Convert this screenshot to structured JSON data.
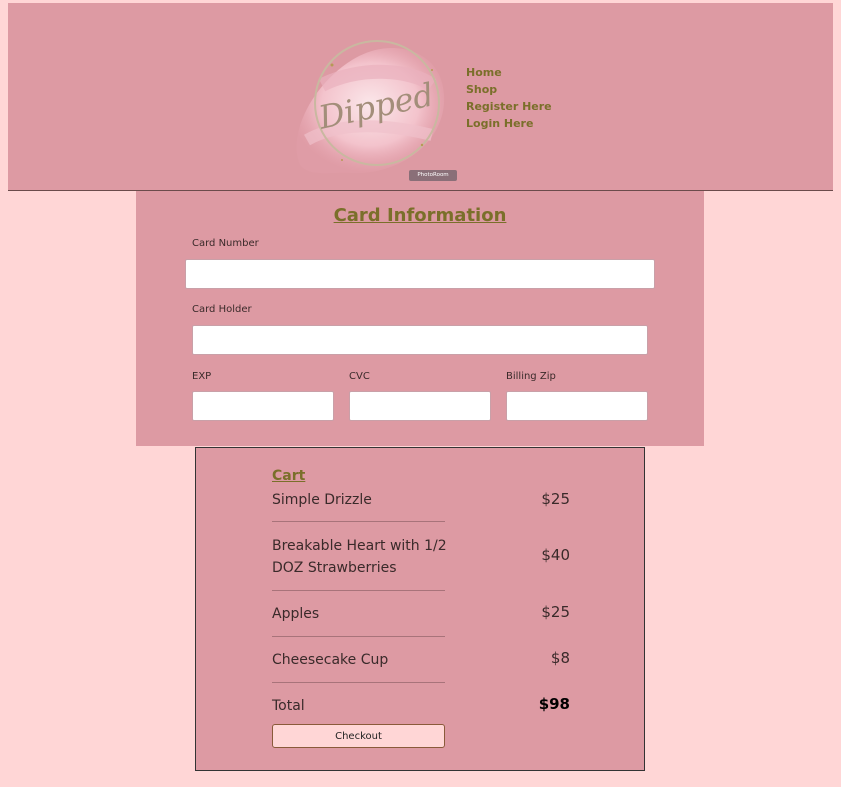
{
  "brand": {
    "logo_text": "Dipped",
    "watermark": "PhotoRoom"
  },
  "nav": {
    "items": [
      "Home",
      "Shop",
      "Register Here",
      "Login Here"
    ]
  },
  "card_form": {
    "title": "Card Information",
    "card_number_label": "Card Number",
    "card_number_value": "",
    "card_holder_label": "Card Holder",
    "card_holder_value": "",
    "exp_label": "EXP",
    "exp_value": "",
    "cvc_label": "CVC",
    "cvc_value": "",
    "zip_label": "Billing Zip",
    "zip_value": ""
  },
  "cart": {
    "title": "Cart",
    "items": [
      {
        "name": "Simple Drizzle",
        "price": "$25"
      },
      {
        "name": "Breakable Heart with 1/2 DOZ Strawberries",
        "price": "$40"
      },
      {
        "name": "Apples",
        "price": "$25"
      },
      {
        "name": "Cheesecake Cup",
        "price": "$8"
      }
    ],
    "total_label": "Total",
    "total_value": "$98",
    "checkout_label": "Checkout"
  },
  "colors": {
    "page_background": "#ffd6d6",
    "panel_background": "#dd9aa3",
    "accent_text": "#7a6f2a"
  }
}
